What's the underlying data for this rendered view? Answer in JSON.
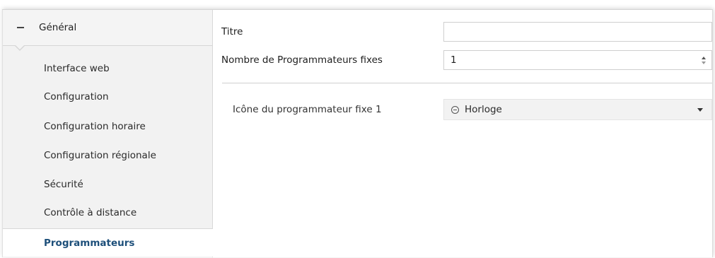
{
  "sidebar": {
    "group": {
      "label": "Général",
      "icon": "collapse-minus-icon"
    },
    "items": [
      {
        "label": "Interface web",
        "active": false
      },
      {
        "label": "Configuration",
        "active": false
      },
      {
        "label": "Configuration horaire",
        "active": false
      },
      {
        "label": "Configuration régionale",
        "active": false
      },
      {
        "label": "Sécurité",
        "active": false
      },
      {
        "label": "Contrôle à distance",
        "active": false
      },
      {
        "label": "Programmateurs",
        "active": true
      }
    ]
  },
  "main": {
    "title_field": {
      "label": "Titre",
      "value": ""
    },
    "count_field": {
      "label": "Nombre de Programmateurs fixes",
      "value": "1"
    },
    "icon_field": {
      "label": "Icône du programmateur fixe 1",
      "value": "Horloge",
      "icon": "clock-icon"
    }
  },
  "colors": {
    "active_item": "#1d4f7a",
    "sidebar_bg": "#f2f2f2",
    "select_bg": "#f2f2f2"
  }
}
